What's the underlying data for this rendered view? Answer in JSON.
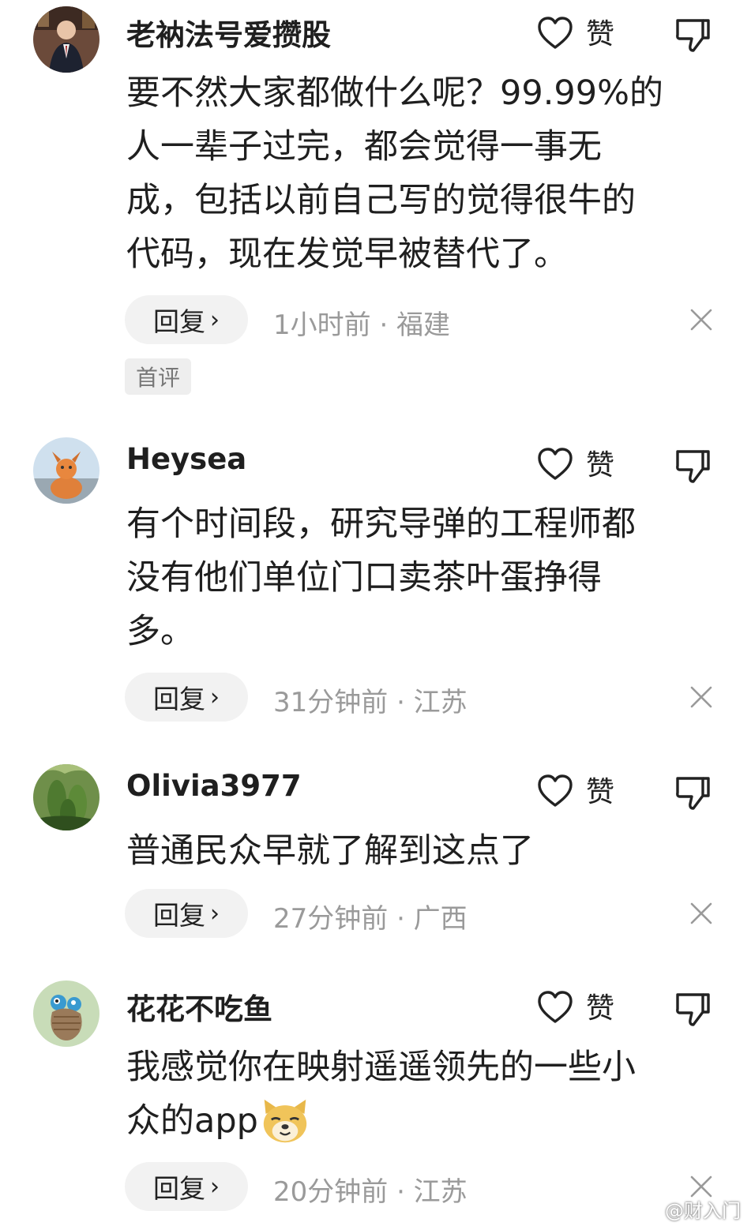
{
  "like_label": "赞",
  "reply_label": "回复",
  "reply_chevron": "›",
  "first_comment_badge": "首评",
  "watermark_text": "@财入门",
  "comments": [
    {
      "username": "老衲法号爱攒股",
      "lines": [
        "要不然大家都做什么呢？99.99%的",
        "人一辈子过完，都会觉得一事无",
        "成，包括以前自己写的觉得很牛的",
        "代码，现在发觉早被替代了。"
      ],
      "meta": "1小时前 · 福建"
    },
    {
      "username": "Heysea",
      "lines": [
        "有个时间段，研究导弹的工程师都",
        "没有他们单位门口卖茶叶蛋挣得",
        "多。"
      ],
      "meta": "31分钟前 · 江苏"
    },
    {
      "username": "Olivia3977",
      "lines": [
        "普通民众早就了解到这点了"
      ],
      "meta": "27分钟前 · 广西"
    },
    {
      "username": "花花不吃鱼",
      "lines": [
        "我感觉你在映射遥遥领先的一些小",
        "众的app"
      ],
      "emoji": "doge-emoji",
      "meta": "20分钟前 · 江苏"
    }
  ],
  "icons": {
    "like": "heart-outline-icon",
    "dislike": "thumbs-down-icon",
    "close": "close-x-icon",
    "watermark_logo": "weibo-logo-icon"
  },
  "colors": {
    "text": "#1f1f1f",
    "meta": "#9a9a9a",
    "reply_bg": "#f2f2f2",
    "badge_bg": "#eeeeee"
  }
}
